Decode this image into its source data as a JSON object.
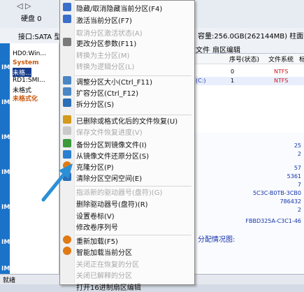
{
  "app": {
    "nav_arrows": "◁ ▷",
    "disk_label": "硬盘 0",
    "disk_num": "0",
    "interface": "接口:SATA 型号",
    "capacity_info": "容量:256.0GB(262144MB) 柱面数:3",
    "left_strip": [
      "IM",
      "IM",
      "IM",
      "IM",
      "IM",
      "IM",
      "IM"
    ],
    "tree": [
      "HD0:Win...",
      "System",
      "未格...",
      "RD1:SMI...",
      "未格式",
      "未格式化"
    ],
    "tabs": [
      "文件",
      "扇区编辑"
    ],
    "columns": [
      "序号(状态)",
      "文件系统",
      "标"
    ],
    "rows": [
      {
        "name": "",
        "num": "0",
        "fs": "NTFS"
      },
      {
        "name": "(C:)",
        "num": "1",
        "fs": "NTFS"
      }
    ],
    "detail_values": [
      "25",
      "2",
      "57",
      "5361",
      "7",
      "5C3C-B0TB-3CB0",
      "786432",
      "2",
      "FBBD325A-C3C1-46"
    ],
    "distribution_label": "分配情况图:",
    "status_text": "就绪"
  },
  "menu": {
    "items": [
      {
        "label": "隐藏/取消隐藏当前分区(F4)",
        "disabled": false,
        "icon": "hide-icon",
        "color": "#3b6fc9"
      },
      {
        "label": "激活当前分区(F7)",
        "disabled": false,
        "icon": "activate-icon",
        "color": "#3b6fc9"
      },
      {
        "label": "取消分区激活状态(A)",
        "disabled": true,
        "icon": "",
        "color": ""
      },
      {
        "label": "更改分区参数(F11)",
        "disabled": false,
        "icon": "params-icon",
        "color": "#7a7a7a"
      },
      {
        "label": "转换为主分区(M)",
        "disabled": true,
        "icon": "",
        "color": ""
      },
      {
        "label": "转换为逻辑分区(L)",
        "disabled": true,
        "icon": "",
        "color": ""
      },
      {
        "label": "调整分区大小(Ctrl_F11)",
        "disabled": false,
        "icon": "resize-icon",
        "color": "#4a86c5"
      },
      {
        "label": "扩容分区(Ctrl_F12)",
        "disabled": false,
        "icon": "extend-icon",
        "color": "#4a86c5"
      },
      {
        "label": "拆分分区(S)",
        "disabled": false,
        "icon": "split-icon",
        "color": "#2b6fb8"
      },
      {
        "label": "已删除或格式化后的文件恢复(U)",
        "disabled": false,
        "icon": "recover-icon",
        "color": "#d49a1d"
      },
      {
        "label": "保存文件恢复进度(V)",
        "disabled": true,
        "icon": "save-progress-icon",
        "color": "#c9c9c9"
      },
      {
        "label": "备份分区到镜像文件(I)",
        "disabled": false,
        "icon": "backup-icon",
        "color": "#3c9a3c"
      },
      {
        "label": "从镜像文件还原分区(S)",
        "disabled": false,
        "icon": "restore-icon",
        "color": "#2b7fd1"
      },
      {
        "label": "克隆分区(P)",
        "disabled": false,
        "icon": "clone-icon",
        "color": "#e07a14"
      },
      {
        "label": "清除分区空闲空间(E)",
        "disabled": false,
        "icon": "clear-free-icon",
        "color": "#2b6fb8"
      },
      {
        "label": "指派新的驱动器号(盘符)(G)",
        "disabled": true,
        "icon": "",
        "color": ""
      },
      {
        "label": "删除驱动器号(盘符)(R)",
        "disabled": false,
        "icon": "",
        "color": ""
      },
      {
        "label": "设置卷标(V)",
        "disabled": false,
        "icon": "",
        "color": ""
      },
      {
        "label": "修改卷序列号",
        "disabled": false,
        "icon": "",
        "color": ""
      },
      {
        "label": "重新加载(F5)",
        "disabled": false,
        "icon": "reload-icon",
        "color": "#e07a14"
      },
      {
        "label": "智能加载当前分区",
        "disabled": false,
        "icon": "smart-load-icon",
        "color": "#e07a14"
      },
      {
        "label": "关闭正在恢复的分区",
        "disabled": true,
        "icon": "",
        "color": ""
      },
      {
        "label": "关闭已解释的分区",
        "disabled": true,
        "icon": "",
        "color": ""
      },
      {
        "label": "打开16进制扇区编辑",
        "disabled": false,
        "icon": "",
        "color": ""
      }
    ]
  },
  "colors": {
    "arrow": "#2b8fd6",
    "strip": "#1a73c9",
    "selected": "#173c8c"
  }
}
